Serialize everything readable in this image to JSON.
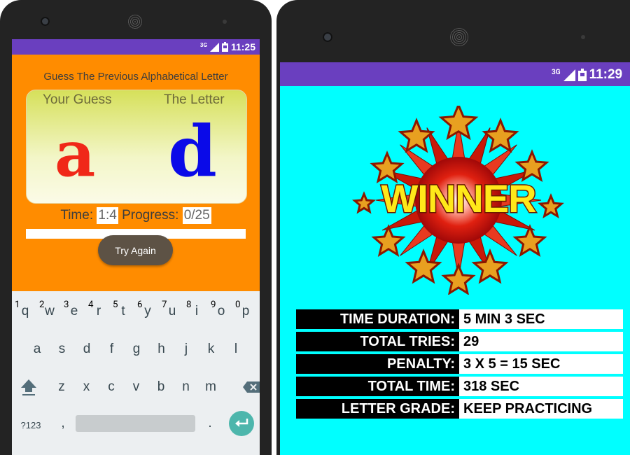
{
  "left_screen": {
    "status_time": "11:25",
    "network": "3G",
    "instruction": "Guess The Previous Alphabetical Letter",
    "your_guess_label": "Your Guess",
    "the_letter_label": "The Letter",
    "guess_letter": "a",
    "target_letter": "d",
    "time_label": "Time:",
    "time_value": "1:4",
    "progress_label": "Progress:",
    "progress_value": "0/25",
    "progress_fraction": 0,
    "try_again_label": "Try Again",
    "keyboard": {
      "row1": [
        "q",
        "w",
        "e",
        "r",
        "t",
        "y",
        "u",
        "i",
        "o",
        "p"
      ],
      "row1_numbers": [
        "1",
        "2",
        "3",
        "4",
        "5",
        "6",
        "7",
        "8",
        "9",
        "0"
      ],
      "row2": [
        "a",
        "s",
        "d",
        "f",
        "g",
        "h",
        "j",
        "k",
        "l"
      ],
      "row3": [
        "z",
        "x",
        "c",
        "v",
        "b",
        "n",
        "m"
      ],
      "symbols_key": "?123",
      "comma_key": ",",
      "period_key": "."
    }
  },
  "right_screen": {
    "status_time": "11:29",
    "network": "3G",
    "badge_text": "WINNER",
    "stats": [
      {
        "label": "TIME DURATION:",
        "value": "5 MIN 3 SEC"
      },
      {
        "label": "TOTAL TRIES:",
        "value": "29"
      },
      {
        "label": "PENALTY:",
        "value": "3 X 5 = 15 SEC"
      },
      {
        "label": "TOTAL TIME:",
        "value": "318 SEC"
      },
      {
        "label": "LETTER GRADE:",
        "value": "KEEP PRACTICING"
      }
    ]
  },
  "colors": {
    "status_bar": "#6a3fbf",
    "left_background": "#ff8c00",
    "right_background": "#00ffff",
    "guess_letter_color": "#f02818",
    "target_letter_color": "#0a0ae8",
    "try_again_button": "#5d5245"
  }
}
